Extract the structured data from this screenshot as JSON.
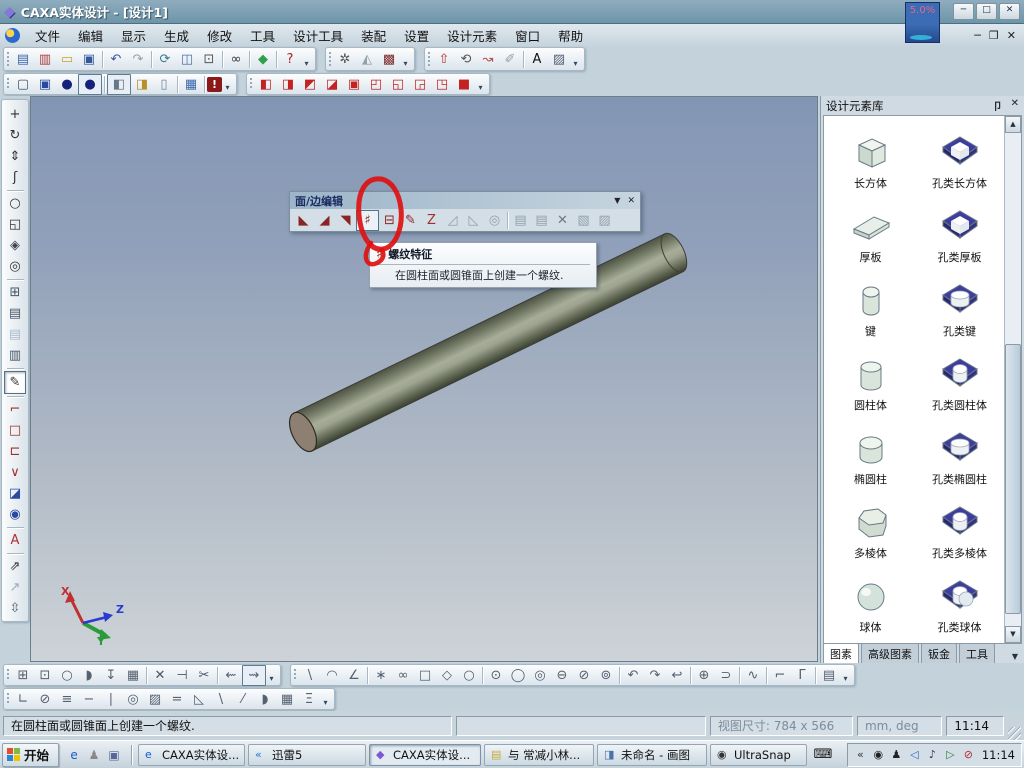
{
  "window": {
    "title": "CAXA实体设计 - [设计1]",
    "minimize": "─",
    "maximize": "□",
    "close": "✕"
  },
  "badge": {
    "text": "5.0%"
  },
  "mdi": {
    "minimize": "─",
    "restore": "❐",
    "close": "✕"
  },
  "menus": [
    {
      "label": "文件",
      "n": "menu-file"
    },
    {
      "label": "编辑",
      "n": "menu-edit"
    },
    {
      "label": "显示",
      "n": "menu-view"
    },
    {
      "label": "生成",
      "n": "menu-generate"
    },
    {
      "label": "修改",
      "n": "menu-modify"
    },
    {
      "label": "工具",
      "n": "menu-tools"
    },
    {
      "label": "设计工具",
      "n": "menu-design-tools"
    },
    {
      "label": "装配",
      "n": "menu-assembly"
    },
    {
      "label": "设置",
      "n": "menu-settings"
    },
    {
      "label": "设计元素",
      "n": "menu-design-elements"
    },
    {
      "label": "窗口",
      "n": "menu-window"
    },
    {
      "label": "帮助",
      "n": "menu-help"
    }
  ],
  "toolbar1": {
    "g1": [
      {
        "n": "new-file-icon",
        "g": "▤",
        "c": "#3a66a8"
      },
      {
        "n": "new-template-icon",
        "g": "▥",
        "c": "#a83a3a"
      },
      {
        "n": "open-icon",
        "g": "▭",
        "c": "#c9a227"
      },
      {
        "n": "save-icon",
        "g": "▣",
        "c": "#33589e"
      },
      {
        "sep": true
      },
      {
        "n": "undo-icon",
        "g": "↶",
        "c": "#3a56a0"
      },
      {
        "n": "redo-icon",
        "g": "↷",
        "c": "#93a1ab"
      },
      {
        "sep": true
      },
      {
        "n": "rotate-view-icon",
        "g": "⟳",
        "c": "#3a7a8a"
      },
      {
        "n": "copy-icon",
        "g": "◫",
        "c": "#4a72a8"
      },
      {
        "n": "lock-icon",
        "g": "⊡",
        "c": "#555555"
      },
      {
        "sep": true
      },
      {
        "n": "search-icon",
        "g": "∞",
        "c": "#333333"
      },
      {
        "sep": true
      },
      {
        "n": "work-plane-icon",
        "g": "◆",
        "c": "#2fa04a"
      },
      {
        "sep": true
      },
      {
        "n": "context-help-icon",
        "g": "?",
        "c": "#b02020"
      }
    ],
    "g2": [
      {
        "n": "animation-icon",
        "g": "✲",
        "c": "#555555"
      },
      {
        "n": "shadow-render-icon",
        "g": "◭",
        "c": "#93a1ab"
      },
      {
        "n": "scene-render-icon",
        "g": "▩",
        "c": "#7a2a2a"
      }
    ],
    "g3": [
      {
        "n": "extrude-icon",
        "g": "⇧",
        "c": "#b03030"
      },
      {
        "n": "revolve-icon",
        "g": "⟲",
        "c": "#555555"
      },
      {
        "n": "sweep-icon",
        "g": "↝",
        "c": "#b05050"
      },
      {
        "n": "eraser-icon",
        "g": "✐",
        "c": "#93a1ab"
      },
      {
        "sep": true
      },
      {
        "n": "text-icon",
        "g": "A",
        "c": "#111111"
      },
      {
        "n": "pattern-icon",
        "g": "▨",
        "c": "#556070"
      }
    ]
  },
  "toolbar2": {
    "g1": [
      {
        "n": "wireframe-display-icon",
        "g": "▢",
        "c": "#445566"
      },
      {
        "n": "wireframe-hidden-icon",
        "g": "▣",
        "c": "#2a4aa0"
      },
      {
        "n": "smooth-shade-icon",
        "g": "●",
        "c": "#16217a"
      },
      {
        "n": "smooth-shade-edges-icon",
        "g": "●",
        "c": "#16217a",
        "k": "boxed"
      },
      {
        "sep": true
      },
      {
        "n": "shaded-display-icon",
        "g": "◧",
        "c": "#667788",
        "k": "boxed"
      },
      {
        "n": "shaded-edges-icon",
        "g": "◨",
        "c": "#b8902a"
      },
      {
        "n": "cylinder-display-icon",
        "g": "▯",
        "c": "#778899"
      },
      {
        "sep": true
      },
      {
        "n": "property-sheet-icon",
        "g": "▦",
        "c": "#3a66a8"
      },
      {
        "sep": true
      },
      {
        "n": "render-alert-icon",
        "g": "!",
        "c": "#ffffff",
        "k": "redbook"
      }
    ],
    "g2": [
      {
        "n": "red-cube-op-1-icon",
        "g": "◧",
        "c": "#c32222"
      },
      {
        "n": "red-cube-op-2-icon",
        "g": "◨",
        "c": "#c32222"
      },
      {
        "n": "red-cube-op-3-icon",
        "g": "◩",
        "c": "#c32222"
      },
      {
        "n": "red-cube-op-4-icon",
        "g": "◪",
        "c": "#c32222"
      },
      {
        "n": "red-cube-op-5-icon",
        "g": "▣",
        "c": "#c32222"
      },
      {
        "n": "red-cube-op-6-icon",
        "g": "◰",
        "c": "#c32222"
      },
      {
        "n": "red-cube-op-7-icon",
        "g": "◱",
        "c": "#c32222"
      },
      {
        "n": "red-cube-op-8-icon",
        "g": "◲",
        "c": "#c32222"
      },
      {
        "n": "red-cube-op-9-icon",
        "g": "◳",
        "c": "#c32222"
      },
      {
        "n": "red-cube-op-10-icon",
        "g": "■",
        "c": "#c32222"
      }
    ]
  },
  "leftbar": [
    {
      "n": "pan-view-icon",
      "g": "+",
      "c": "#333333"
    },
    {
      "n": "orbit-view-icon",
      "g": "↻",
      "c": "#333333"
    },
    {
      "n": "elevate-view-icon",
      "g": "⇕",
      "c": "#333333"
    },
    {
      "n": "fly-path-icon",
      "g": "ʃ",
      "c": "#333333"
    },
    {
      "sep": true,
      "h": true
    },
    {
      "n": "zoom-icon",
      "g": "○",
      "c": "#333333"
    },
    {
      "n": "zoom-window-icon",
      "g": "◱",
      "c": "#333333"
    },
    {
      "n": "zoom-extents-icon",
      "g": "◈",
      "c": "#444455"
    },
    {
      "n": "zoom-target-icon",
      "g": "◎",
      "c": "#333333"
    },
    {
      "sep": true,
      "h": true
    },
    {
      "n": "new-view-icon",
      "g": "⊞",
      "c": "#445566"
    },
    {
      "n": "camera-rotate-icon",
      "g": "▤",
      "c": "#445566"
    },
    {
      "n": "camera-off-icon",
      "g": "▤",
      "c": "#aabbcc"
    },
    {
      "n": "camera-multi-icon",
      "g": "▥",
      "c": "#445566"
    },
    {
      "sep": true,
      "h": true
    },
    {
      "n": "edit-feature-icon",
      "g": "✎",
      "c": "#333333",
      "k": "pressed"
    },
    {
      "sep": true,
      "h": true
    },
    {
      "n": "corner-dimension-icon",
      "g": "⌐",
      "c": "#a03030"
    },
    {
      "n": "rect-dimension-icon",
      "g": "□",
      "c": "#a03030"
    },
    {
      "n": "linear-dimension-icon",
      "g": "⊏",
      "c": "#a03030"
    },
    {
      "n": "angle-dimension-icon",
      "g": "∨",
      "c": "#a03030"
    },
    {
      "n": "face-select-icon",
      "g": "◪",
      "c": "#2a4aa0"
    },
    {
      "n": "round-face-icon",
      "g": "◉",
      "c": "#2a4aa0"
    },
    {
      "sep": true,
      "h": true
    },
    {
      "n": "annotation-icon",
      "g": "A",
      "c": "#b03030"
    },
    {
      "sep": true,
      "h": true
    },
    {
      "n": "measure-two-icon",
      "g": "⇗",
      "c": "#333333"
    },
    {
      "n": "measure-one-icon",
      "g": "↗",
      "c": "#99aabb"
    },
    {
      "n": "strip-expand-icon",
      "g": "⇳",
      "c": "#556677"
    }
  ],
  "float_toolbar": {
    "title": "面/边编辑",
    "menu_btn": "▼",
    "close_btn": "✕",
    "icons": [
      {
        "n": "face-draft-icon",
        "g": "◣",
        "c": "#8a2525"
      },
      {
        "n": "edge-fillet-icon",
        "g": "◢",
        "c": "#8a2525"
      },
      {
        "n": "edge-chamfer-icon",
        "g": "◥",
        "c": "#8a2525"
      },
      {
        "n": "thread-feature-icon",
        "g": "♯",
        "c": "#8a2525",
        "k": "hover"
      },
      {
        "n": "shell-icon",
        "g": "⊟",
        "c": "#8a2525"
      },
      {
        "n": "face-move-icon",
        "g": "✎",
        "c": "#8a2525"
      },
      {
        "n": "face-match-icon",
        "g": "Z",
        "c": "#a03030"
      },
      {
        "n": "surface-split-icon",
        "g": "◿",
        "c": "#93a1ab"
      },
      {
        "n": "surface-trim-icon",
        "g": "◺",
        "c": "#93a1ab"
      },
      {
        "n": "surface-stitch-icon",
        "g": "◎",
        "c": "#93a1ab"
      },
      {
        "sep": true
      },
      {
        "n": "face-copy-icon",
        "g": "▤",
        "c": "#93a1ab"
      },
      {
        "n": "face-offset-icon",
        "g": "▤",
        "c": "#93a1ab"
      },
      {
        "n": "remove-face-icon",
        "g": "✕",
        "c": "#6a7a84"
      },
      {
        "n": "replace-face-icon",
        "g": "▧",
        "c": "#93a1ab"
      },
      {
        "n": "patch-face-icon",
        "g": "▨",
        "c": "#93a1ab"
      }
    ]
  },
  "tooltip": {
    "title": "螺纹特征",
    "text": "在圆柱面或圆锥面上创建一个螺纹.",
    "icon_glyph": "♯"
  },
  "triad": {
    "x": "X",
    "y": "Y",
    "z": "Z"
  },
  "panel": {
    "title": "设计元素库",
    "pin_btn": "卩",
    "close_btn": "✕",
    "items": [
      {
        "label": "长方体",
        "shape": "box",
        "n": "lib-cuboid"
      },
      {
        "label": "孔类长方体",
        "shape": "holebox",
        "n": "lib-hole-cuboid"
      },
      {
        "label": "厚板",
        "shape": "plate",
        "n": "lib-slab"
      },
      {
        "label": "孔类厚板",
        "shape": "holebox",
        "n": "lib-hole-slab"
      },
      {
        "label": "键",
        "shape": "key",
        "n": "lib-key"
      },
      {
        "label": "孔类键",
        "shape": "holeell",
        "n": "lib-hole-key"
      },
      {
        "label": "圆柱体",
        "shape": "cyl",
        "n": "lib-cylinder"
      },
      {
        "label": "孔类圆柱体",
        "shape": "holecyl",
        "n": "lib-hole-cylinder"
      },
      {
        "label": "椭圆柱",
        "shape": "ellcyl",
        "n": "lib-elliptic-cylinder"
      },
      {
        "label": "孔类椭圆柱",
        "shape": "holeell",
        "n": "lib-hole-elliptic-cylinder"
      },
      {
        "label": "多棱体",
        "shape": "poly",
        "n": "lib-polyhedron"
      },
      {
        "label": "孔类多棱体",
        "shape": "holecyl",
        "n": "lib-hole-polyhedron"
      },
      {
        "label": "球体",
        "shape": "sphere",
        "n": "lib-sphere"
      },
      {
        "label": "孔类球体",
        "shape": "holesph",
        "n": "lib-hole-sphere"
      }
    ],
    "tabs": [
      {
        "label": "图素",
        "n": "tab-primitives",
        "active": true
      },
      {
        "label": "高级图素",
        "n": "tab-advanced-primitives"
      },
      {
        "label": "钣金",
        "n": "tab-sheet-metal"
      },
      {
        "label": "工具",
        "n": "tab-tools"
      }
    ]
  },
  "bottom1a": [
    {
      "n": "sketch-grid-icon",
      "g": "⊞",
      "c": "#556070"
    },
    {
      "n": "sketch-scale-icon",
      "g": "⊡",
      "c": "#556070"
    },
    {
      "n": "sketch-rotate-icon",
      "g": "○",
      "c": "#556070"
    },
    {
      "n": "sketch-mirror-icon",
      "g": "◗",
      "c": "#556070"
    },
    {
      "n": "sketch-move-icon",
      "g": "↧",
      "c": "#556070"
    },
    {
      "n": "sketch-stamp-icon",
      "g": "▦",
      "c": "#556070"
    },
    {
      "sep": true
    },
    {
      "n": "delete-icon",
      "g": "✕",
      "c": "#445566"
    },
    {
      "n": "trim-icon",
      "g": "⊣",
      "c": "#445566"
    },
    {
      "n": "break-icon",
      "g": "✂",
      "c": "#445566"
    },
    {
      "sep": true
    },
    {
      "n": "direction-1-icon",
      "g": "⇜",
      "c": "#556070"
    },
    {
      "n": "direction-2-icon",
      "g": "⇝",
      "c": "#556070",
      "k": "boxed"
    }
  ],
  "bottom1b": [
    {
      "n": "line-icon",
      "g": "\\",
      "c": "#556070"
    },
    {
      "n": "arc-icon",
      "g": "◠",
      "c": "#556070"
    },
    {
      "n": "angle-line-icon",
      "g": "∠",
      "c": "#556070"
    },
    {
      "sep": true
    },
    {
      "n": "point-icon",
      "g": "∗",
      "c": "#556070"
    },
    {
      "n": "tangent-circles-icon",
      "g": "∞",
      "c": "#556070"
    },
    {
      "n": "rectangle-icon",
      "g": "□",
      "c": "#556070"
    },
    {
      "n": "diamond-icon",
      "g": "◇",
      "c": "#556070"
    },
    {
      "n": "polygon-icon",
      "g": "○",
      "c": "#556070"
    },
    {
      "sep": true
    },
    {
      "n": "circle-center-icon",
      "g": "⊙",
      "c": "#556070"
    },
    {
      "n": "circle-2pt-icon",
      "g": "◯",
      "c": "#556070"
    },
    {
      "n": "circle-3pt-icon",
      "g": "◎",
      "c": "#556070"
    },
    {
      "n": "ellipse-icon",
      "g": "⊖",
      "c": "#556070"
    },
    {
      "n": "ellipse-axis-icon",
      "g": "⊘",
      "c": "#556070"
    },
    {
      "n": "ellipse-arc-icon",
      "g": "⊚",
      "c": "#556070"
    },
    {
      "sep": true
    },
    {
      "n": "arc-ccw-icon",
      "g": "↶",
      "c": "#556070"
    },
    {
      "n": "arc-cw-icon",
      "g": "↷",
      "c": "#556070"
    },
    {
      "n": "arc-continue-icon",
      "g": "↩",
      "c": "#556070"
    },
    {
      "sep": true
    },
    {
      "n": "spline-icon",
      "g": "⊕",
      "c": "#556070"
    },
    {
      "n": "curve-fit-icon",
      "g": "⊃",
      "c": "#556070"
    },
    {
      "sep": true
    },
    {
      "n": "wave-icon",
      "g": "∿",
      "c": "#556070"
    },
    {
      "sep": true
    },
    {
      "n": "corner-icon",
      "g": "⌐",
      "c": "#556070"
    },
    {
      "n": "corner-2-icon",
      "g": "Γ",
      "c": "#556070"
    },
    {
      "sep": true
    },
    {
      "n": "hatch-icon",
      "g": "▤",
      "c": "#556070"
    }
  ],
  "bottom2": [
    {
      "n": "perpendicular-icon",
      "g": "∟",
      "c": "#556070"
    },
    {
      "n": "no-constraint-icon",
      "g": "⊘",
      "c": "#556070"
    },
    {
      "n": "parallel-hatch-icon",
      "g": "≡",
      "c": "#556070"
    },
    {
      "n": "horizontal-icon",
      "g": "−",
      "c": "#556070"
    },
    {
      "n": "vertical-icon",
      "g": "∣",
      "c": "#556070"
    },
    {
      "n": "concentric-icon",
      "g": "◎",
      "c": "#556070"
    },
    {
      "n": "tangent-icon",
      "g": "▨",
      "c": "#556070"
    },
    {
      "n": "equal-icon",
      "g": "=",
      "c": "#556070"
    },
    {
      "n": "angle-constraint-icon",
      "g": "◺",
      "c": "#556070"
    },
    {
      "n": "slope-icon",
      "g": "\\",
      "c": "#556070"
    },
    {
      "n": "cross-icon",
      "g": "⁄",
      "c": "#556070"
    },
    {
      "n": "symmetric-icon",
      "g": "◗",
      "c": "#556070"
    },
    {
      "n": "fill-icon",
      "g": "▦",
      "c": "#556070"
    },
    {
      "n": "midline-icon",
      "g": "Ξ",
      "c": "#556070"
    }
  ],
  "statusbar": {
    "message": "在圆柱面或圆锥面上创建一个螺纹.",
    "view_size": "视图尺寸: 784 x 566",
    "units": "mm, deg",
    "time": "11:14"
  },
  "taskbar": {
    "start": "开始",
    "quicklaunch": [
      {
        "n": "ie-quicklaunch-icon",
        "g": "e",
        "c": "#1a5ad0"
      },
      {
        "n": "messenger-quicklaunch-icon",
        "g": "♟",
        "c": "#888888"
      },
      {
        "n": "show-desktop-icon",
        "g": "▣",
        "c": "#556699"
      }
    ],
    "tasks": [
      {
        "label": "CAXA实体设...",
        "g": "e",
        "c": "#1a5ad0",
        "n": "task-caxa-web"
      },
      {
        "label": "迅雷5",
        "g": "«",
        "c": "#1a7ad0",
        "n": "task-thunder5"
      },
      {
        "label": "CAXA实体设...",
        "g": "◆",
        "c": "#7a5ad0",
        "active": true,
        "n": "task-caxa-design"
      },
      {
        "label": "与 常减小林...",
        "g": "▤",
        "c": "#c9a93a",
        "n": "task-notepad"
      },
      {
        "label": "未命名 - 画图",
        "g": "◨",
        "c": "#4a72a8",
        "n": "task-paint"
      },
      {
        "label": "UltraSnap",
        "g": "◉",
        "c": "#333333",
        "n": "task-ultrasnap"
      }
    ],
    "keyboard_glyph": "⌨",
    "tray": [
      {
        "n": "tray-collapse-icon",
        "g": "«",
        "c": "#333333"
      },
      {
        "n": "ultrasnap-tray-icon",
        "g": "◉",
        "c": "#222222"
      },
      {
        "n": "qq-tray-icon",
        "g": "♟",
        "c": "#222222"
      },
      {
        "n": "thunder-tray-icon",
        "g": "◁",
        "c": "#2a6ad0"
      },
      {
        "n": "volume-muted-icon",
        "g": "♪",
        "c": "#333355"
      },
      {
        "n": "player-tray-icon",
        "g": "▷",
        "c": "#3a7a3a"
      },
      {
        "n": "blocked-tray-icon",
        "g": "⊘",
        "c": "#b03030"
      }
    ],
    "tray_time": "11:14"
  },
  "colors": {
    "viewport_top": "#8296b4",
    "viewport_bottom": "#cdd3d8",
    "cylinder_mid": "#a8ad99",
    "cylinder_dark": "#3b4034",
    "cap": "#8d8072",
    "annotation_red": "#dd1111",
    "hole_navy": "#3d3d9e"
  }
}
